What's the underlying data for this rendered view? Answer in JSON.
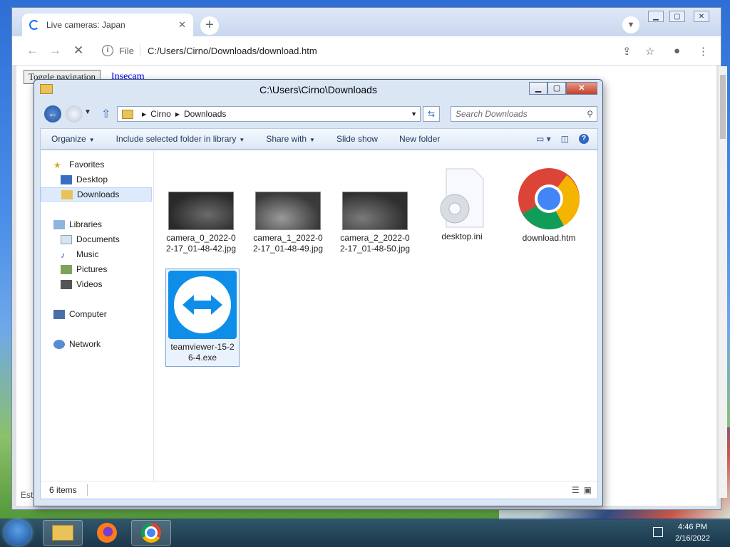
{
  "browser": {
    "tab_title": "Live cameras: Japan",
    "tab_close": "✕",
    "new_tab": "+",
    "address_scheme": "File",
    "address_url": "C:/Users/Cirno/Downloads/download.htm",
    "page": {
      "toggle_nav_label": "Toggle navigation",
      "brand_link": "Insecam",
      "status_partial": "Esta"
    }
  },
  "explorer": {
    "title": "C:\\Users\\Cirno\\Downloads",
    "breadcrumb": [
      "Cirno",
      "Downloads"
    ],
    "search_placeholder": "Search Downloads",
    "commands": [
      {
        "label": "Organize",
        "dropdown": true
      },
      {
        "label": "Include selected folder in library",
        "dropdown": true
      },
      {
        "label": "Share with",
        "dropdown": true
      },
      {
        "label": "Slide show",
        "dropdown": false
      },
      {
        "label": "New folder",
        "dropdown": false
      }
    ],
    "nav": {
      "favorites": "Favorites",
      "desktop": "Desktop",
      "downloads": "Downloads",
      "libraries": "Libraries",
      "documents": "Documents",
      "music": "Music",
      "pictures": "Pictures",
      "videos": "Videos",
      "computer": "Computer",
      "network": "Network"
    },
    "files": [
      {
        "name": "camera_0_2022-02-17_01-48-42.jpg",
        "type": "image"
      },
      {
        "name": "camera_1_2022-02-17_01-48-49.jpg",
        "type": "image"
      },
      {
        "name": "camera_2_2022-02-17_01-48-50.jpg",
        "type": "image"
      },
      {
        "name": "desktop.ini",
        "type": "settings"
      },
      {
        "name": "download.htm",
        "type": "chrome-html"
      },
      {
        "name": "teamviewer-15-26-4.exe",
        "type": "teamviewer",
        "selected": true
      }
    ],
    "status_count": "6 items"
  },
  "taskbar": {
    "time": "4:46 PM",
    "date": "2/16/2022"
  },
  "colors": {
    "chrome_blue": "#1a73e8",
    "teamviewer_blue": "#0e8ee9",
    "selection": "#dceafc"
  }
}
